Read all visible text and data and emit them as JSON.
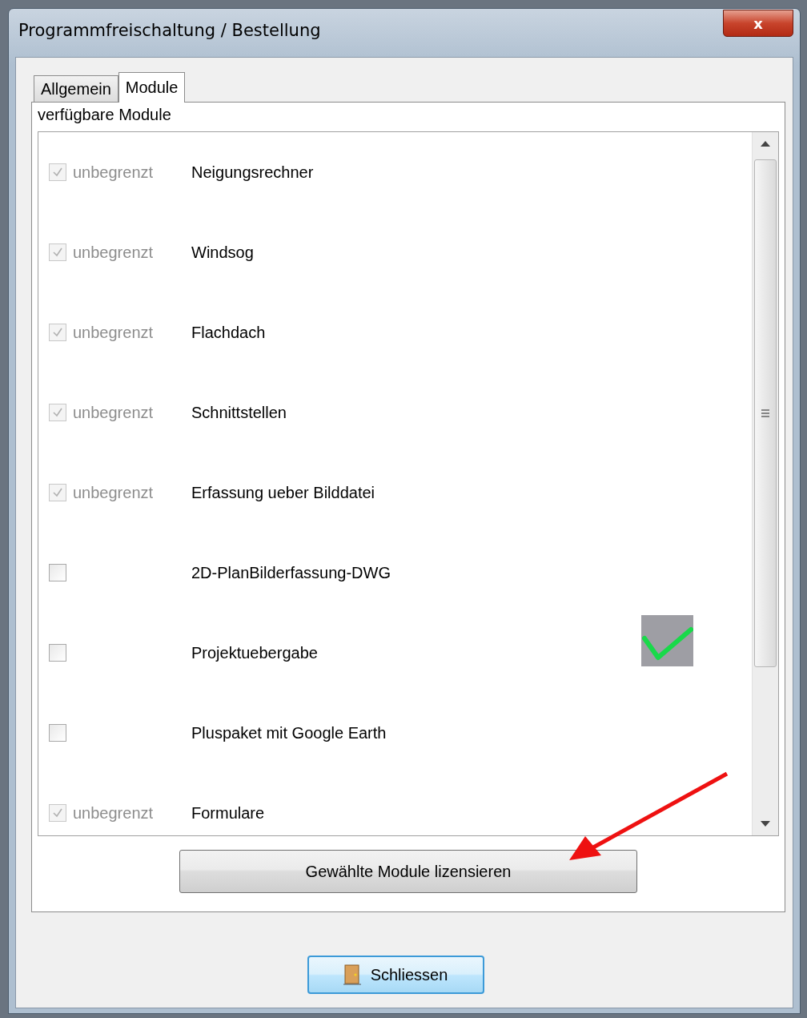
{
  "window": {
    "title": "Programmfreischaltung / Bestellung",
    "close": "x"
  },
  "tabs": [
    {
      "label": "Allgemein",
      "selected": false
    },
    {
      "label": "Module",
      "selected": true
    }
  ],
  "group_label": "verfügbare Module",
  "modules": [
    {
      "checked": true,
      "disabled": true,
      "limit": "unbegrenzt",
      "name": "Neigungsrechner"
    },
    {
      "checked": true,
      "disabled": true,
      "limit": "unbegrenzt",
      "name": "Windsog"
    },
    {
      "checked": true,
      "disabled": true,
      "limit": "unbegrenzt",
      "name": "Flachdach"
    },
    {
      "checked": true,
      "disabled": true,
      "limit": "unbegrenzt",
      "name": "Schnittstellen"
    },
    {
      "checked": true,
      "disabled": true,
      "limit": "unbegrenzt",
      "name": "Erfassung ueber Bilddatei"
    },
    {
      "checked": false,
      "disabled": false,
      "name": "2D-PlanBilderfassung-DWG"
    },
    {
      "checked": false,
      "disabled": false,
      "name": "Projektuebergabe"
    },
    {
      "checked": false,
      "disabled": false,
      "name": "Pluspaket mit Google Earth"
    },
    {
      "checked": true,
      "disabled": true,
      "limit": "unbegrenzt",
      "name": "Formulare"
    }
  ],
  "license_button": "Gewählte Module lizensieren",
  "close_button": "Schliessen"
}
